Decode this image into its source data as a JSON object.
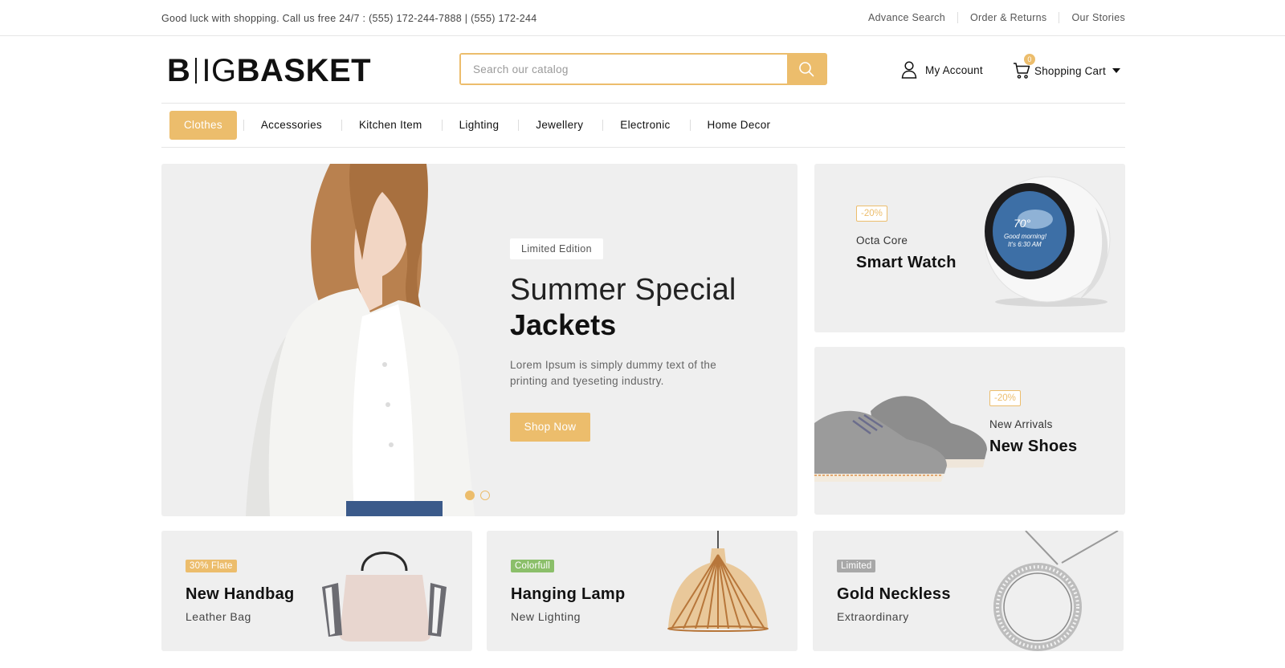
{
  "topbar": {
    "message": "Good luck with shopping. Call us free 24/7 : (555) 172-244-7888 | (555) 172-244",
    "links": [
      "Advance Search",
      "Order & Returns",
      "Our Stories"
    ]
  },
  "header": {
    "logo_part1": "B",
    "logo_part2": "IG",
    "logo_part3": "BASKET",
    "search_placeholder": "Search our catalog",
    "account_label": "My Account",
    "cart_label": "Shopping Cart",
    "cart_count": "0"
  },
  "nav": {
    "items": [
      "Clothes",
      "Accessories",
      "Kitchen Item",
      "Lighting",
      "Jewellery",
      "Electronic",
      "Home Decor"
    ],
    "active": "Clothes"
  },
  "hero": {
    "tag": "Limited Edition",
    "title_line1": "Summer Special",
    "title_line2": "Jackets",
    "description": "Lorem Ipsum is simply dummy text of the printing and tyeseting industry.",
    "button": "Shop Now",
    "slide_count": 2,
    "active_slide": 1
  },
  "side_banners": [
    {
      "discount": "-20%",
      "subtitle": "Octa Core",
      "title": "Smart Watch",
      "screen_temp": "70°",
      "screen_greeting": "Good morning!",
      "screen_time": "It's 6:30 AM"
    },
    {
      "discount": "-20%",
      "subtitle": "New Arrivals",
      "title": "New Shoes"
    }
  ],
  "bottom_banners": [
    {
      "label": "30% Flate",
      "title": "New Handbag",
      "subtitle": "Leather Bag",
      "label_color": "#ecbd6c"
    },
    {
      "label": "Colorfull",
      "title": "Hanging Lamp",
      "subtitle": "New Lighting",
      "label_color": "#8bbf6a"
    },
    {
      "label": "Limited",
      "title": "Gold Neckless",
      "subtitle": "Extraordinary",
      "label_color": "#a8a8a8"
    }
  ],
  "colors": {
    "accent": "#ecbd6c",
    "panel": "#efefef"
  }
}
